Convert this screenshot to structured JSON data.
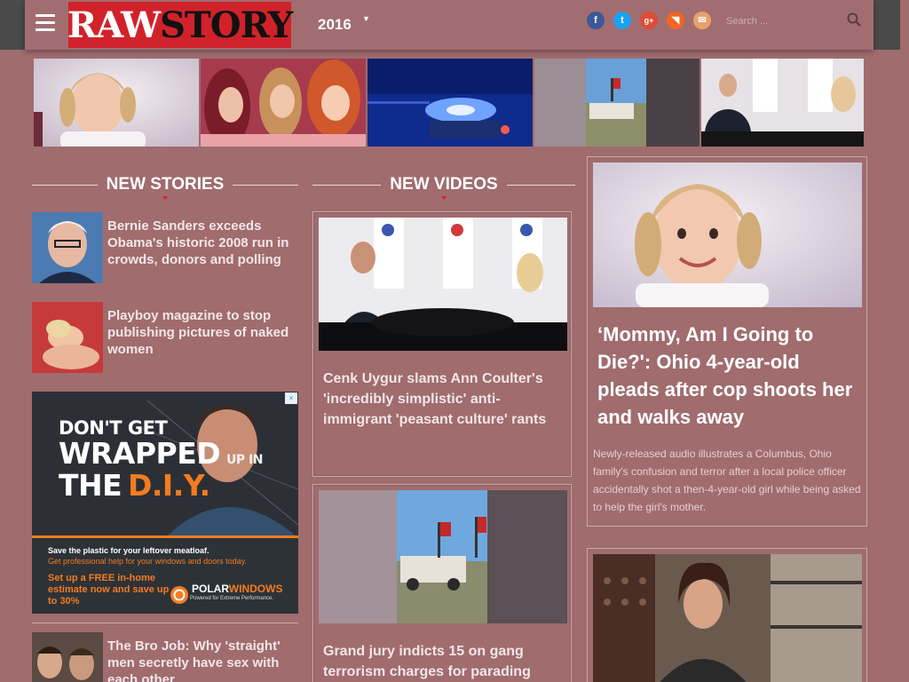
{
  "header": {
    "logo_text": "RAWSTORY",
    "year": "2016",
    "search_placeholder": "Search ...",
    "social": [
      {
        "name": "facebook",
        "glyph": "f",
        "color": "#3b5998"
      },
      {
        "name": "twitter",
        "glyph": "t",
        "color": "#1da1f2"
      },
      {
        "name": "google-plus",
        "glyph": "g+",
        "color": "#dd4b39"
      },
      {
        "name": "rss",
        "glyph": "◥",
        "color": "#f26522"
      },
      {
        "name": "email",
        "glyph": "✉",
        "color": "#e8a16a"
      }
    ]
  },
  "sections": {
    "new_stories": "NEW STORIES",
    "new_videos": "NEW VIDEOS"
  },
  "stories": [
    {
      "title": "Bernie Sanders exceeds Obama's historic 2008 run in crowds, donors and polling"
    },
    {
      "title": "Playboy magazine to stop publishing pictures of naked women"
    },
    {
      "title": "The Bro Job: Why 'straight' men secretly have sex with each other"
    }
  ],
  "ad": {
    "line_dont": "DON'T GET",
    "line_wrapped": "WRAPPED",
    "line_upin": "UP IN",
    "line_the": "THE",
    "line_diy": "D.I.Y.",
    "tagline1": "Save the plastic for your leftover meatloaf.",
    "tagline2": "Get professional help for your windows and doors today.",
    "cta": "Set up a FREE in-home estimate now and save up to 30%",
    "brand_a": "POLAR",
    "brand_b": "WINDOWS",
    "brand_tag": "Powered for Extreme Performance."
  },
  "videos": [
    {
      "title": "Cenk Uygur slams Ann Coulter's 'incredibly simplistic' anti-immigrant 'peasant culture' rants"
    },
    {
      "title": "Grand jury indicts 15 on gang terrorism charges for parading"
    }
  ],
  "feature": {
    "title": "‘Mommy, Am I Going to Die?': Ohio 4-year-old pleads after cop shoots her and walks away",
    "summary": "Newly-released audio illustrates a Columbus, Ohio family's confusion and terror after a local police officer accidentally shot a then-4-year-old girl while being asked to help the girl's mother."
  }
}
